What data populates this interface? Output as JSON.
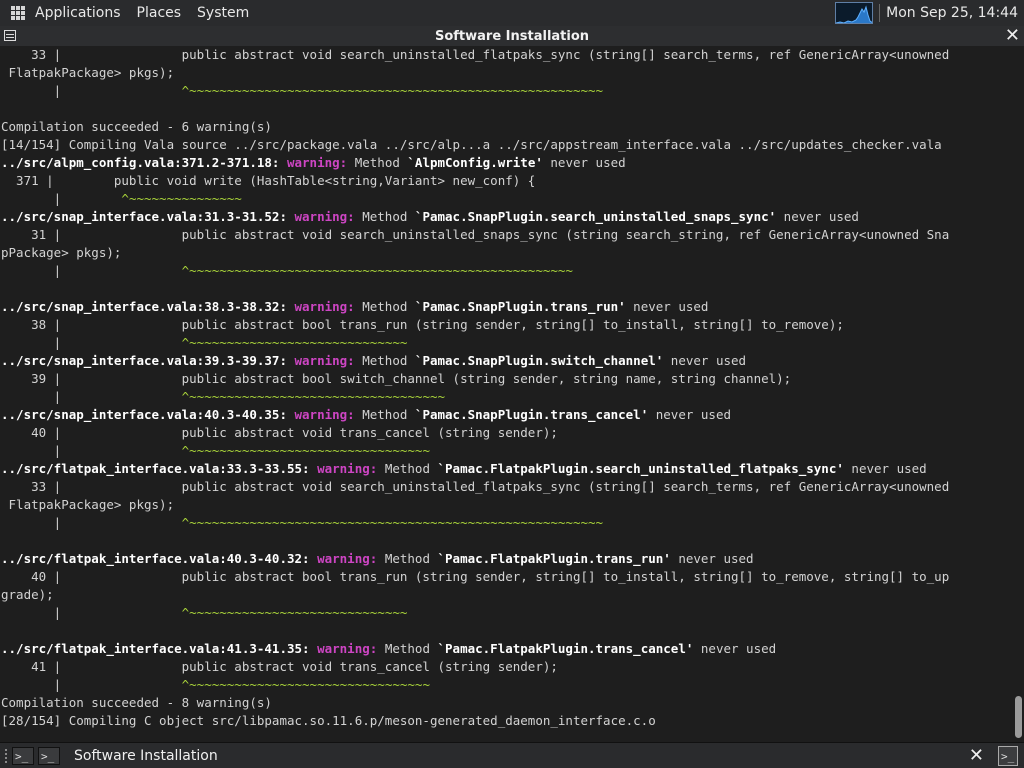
{
  "top_panel": {
    "menus": [
      "Applications",
      "Places",
      "System"
    ],
    "clock": "Mon Sep 25, 14:44"
  },
  "window": {
    "title": "Software Installation",
    "close_glyph": "✕"
  },
  "terminal": {
    "lines": [
      [
        [
          "    33 |                public abstract void search_uninstalled_flatpaks_sync (string[] search_terms, ref GenericArray<unowned",
          "n"
        ]
      ],
      [
        [
          " FlatpakPackage> pkgs);",
          "n"
        ]
      ],
      [
        [
          "       |                ",
          "n"
        ],
        [
          "^~~~~~~~~~~~~~~~~~~~~~~~~~~~~~~~~~~~~~~~~~~~~~~~~~~~~~~~",
          "g"
        ]
      ],
      [
        [
          "",
          "n"
        ]
      ],
      [
        [
          "Compilation succeeded - 6 warning(s)",
          "n"
        ]
      ],
      [
        [
          "[14/154] Compiling Vala source ../src/package.vala ../src/alp...a ../src/appstream_interface.vala ../src/updates_checker.vala",
          "n"
        ]
      ],
      [
        [
          "../src/alpm_config.vala:371.2-371.18: ",
          "b"
        ],
        [
          "warning: ",
          "m"
        ],
        [
          "Method ",
          "n"
        ],
        [
          "`AlpmConfig.write'",
          "b"
        ],
        [
          " never used",
          "n"
        ]
      ],
      [
        [
          "  371 |        public void write (HashTable<string,Variant> new_conf) {",
          "n"
        ]
      ],
      [
        [
          "       |        ",
          "n"
        ],
        [
          "^~~~~~~~~~~~~~~~",
          "g"
        ]
      ],
      [
        [
          "../src/snap_interface.vala:31.3-31.52: ",
          "b"
        ],
        [
          "warning: ",
          "m"
        ],
        [
          "Method ",
          "n"
        ],
        [
          "`Pamac.SnapPlugin.search_uninstalled_snaps_sync'",
          "b"
        ],
        [
          " never used",
          "n"
        ]
      ],
      [
        [
          "    31 |                public abstract void search_uninstalled_snaps_sync (string search_string, ref GenericArray<unowned Sna",
          "n"
        ]
      ],
      [
        [
          "pPackage> pkgs);",
          "n"
        ]
      ],
      [
        [
          "       |                ",
          "n"
        ],
        [
          "^~~~~~~~~~~~~~~~~~~~~~~~~~~~~~~~~~~~~~~~~~~~~~~~~~~~",
          "g"
        ]
      ],
      [
        [
          "",
          "n"
        ]
      ],
      [
        [
          "../src/snap_interface.vala:38.3-38.32: ",
          "b"
        ],
        [
          "warning: ",
          "m"
        ],
        [
          "Method ",
          "n"
        ],
        [
          "`Pamac.SnapPlugin.trans_run'",
          "b"
        ],
        [
          " never used",
          "n"
        ]
      ],
      [
        [
          "    38 |                public abstract bool trans_run (string sender, string[] to_install, string[] to_remove);",
          "n"
        ]
      ],
      [
        [
          "       |                ",
          "n"
        ],
        [
          "^~~~~~~~~~~~~~~~~~~~~~~~~~~~~~",
          "g"
        ]
      ],
      [
        [
          "../src/snap_interface.vala:39.3-39.37: ",
          "b"
        ],
        [
          "warning: ",
          "m"
        ],
        [
          "Method ",
          "n"
        ],
        [
          "`Pamac.SnapPlugin.switch_channel'",
          "b"
        ],
        [
          " never used",
          "n"
        ]
      ],
      [
        [
          "    39 |                public abstract bool switch_channel (string sender, string name, string channel);",
          "n"
        ]
      ],
      [
        [
          "       |                ",
          "n"
        ],
        [
          "^~~~~~~~~~~~~~~~~~~~~~~~~~~~~~~~~~~",
          "g"
        ]
      ],
      [
        [
          "../src/snap_interface.vala:40.3-40.35: ",
          "b"
        ],
        [
          "warning: ",
          "m"
        ],
        [
          "Method ",
          "n"
        ],
        [
          "`Pamac.SnapPlugin.trans_cancel'",
          "b"
        ],
        [
          " never used",
          "n"
        ]
      ],
      [
        [
          "    40 |                public abstract void trans_cancel (string sender);",
          "n"
        ]
      ],
      [
        [
          "       |                ",
          "n"
        ],
        [
          "^~~~~~~~~~~~~~~~~~~~~~~~~~~~~~~~~",
          "g"
        ]
      ],
      [
        [
          "../src/flatpak_interface.vala:33.3-33.55: ",
          "b"
        ],
        [
          "warning: ",
          "m"
        ],
        [
          "Method ",
          "n"
        ],
        [
          "`Pamac.FlatpakPlugin.search_uninstalled_flatpaks_sync'",
          "b"
        ],
        [
          " never used",
          "n"
        ]
      ],
      [
        [
          "    33 |                public abstract void search_uninstalled_flatpaks_sync (string[] search_terms, ref GenericArray<unowned",
          "n"
        ]
      ],
      [
        [
          " FlatpakPackage> pkgs);",
          "n"
        ]
      ],
      [
        [
          "       |                ",
          "n"
        ],
        [
          "^~~~~~~~~~~~~~~~~~~~~~~~~~~~~~~~~~~~~~~~~~~~~~~~~~~~~~~~",
          "g"
        ]
      ],
      [
        [
          "",
          "n"
        ]
      ],
      [
        [
          "../src/flatpak_interface.vala:40.3-40.32: ",
          "b"
        ],
        [
          "warning: ",
          "m"
        ],
        [
          "Method ",
          "n"
        ],
        [
          "`Pamac.FlatpakPlugin.trans_run'",
          "b"
        ],
        [
          " never used",
          "n"
        ]
      ],
      [
        [
          "    40 |                public abstract bool trans_run (string sender, string[] to_install, string[] to_remove, string[] to_up",
          "n"
        ]
      ],
      [
        [
          "grade);",
          "n"
        ]
      ],
      [
        [
          "       |                ",
          "n"
        ],
        [
          "^~~~~~~~~~~~~~~~~~~~~~~~~~~~~~",
          "g"
        ]
      ],
      [
        [
          "",
          "n"
        ]
      ],
      [
        [
          "../src/flatpak_interface.vala:41.3-41.35: ",
          "b"
        ],
        [
          "warning: ",
          "m"
        ],
        [
          "Method ",
          "n"
        ],
        [
          "`Pamac.FlatpakPlugin.trans_cancel'",
          "b"
        ],
        [
          " never used",
          "n"
        ]
      ],
      [
        [
          "    41 |                public abstract void trans_cancel (string sender);",
          "n"
        ]
      ],
      [
        [
          "       |                ",
          "n"
        ],
        [
          "^~~~~~~~~~~~~~~~~~~~~~~~~~~~~~~~~",
          "g"
        ]
      ],
      [
        [
          "Compilation succeeded - 8 warning(s)",
          "n"
        ]
      ],
      [
        [
          "[28/154] Compiling C object src/libpamac.so.11.6.p/meson-generated_daemon_interface.c.o",
          "n"
        ]
      ]
    ]
  },
  "taskbar": {
    "terminal_btn_glyph": ">_",
    "window_title": "Software Installation",
    "close_glyph": "✕"
  },
  "colors": {
    "terminal_bg": "#1e1e1e",
    "warning": "#cd45c3",
    "caret": "#a9d43a",
    "bold": "#ffffff"
  }
}
